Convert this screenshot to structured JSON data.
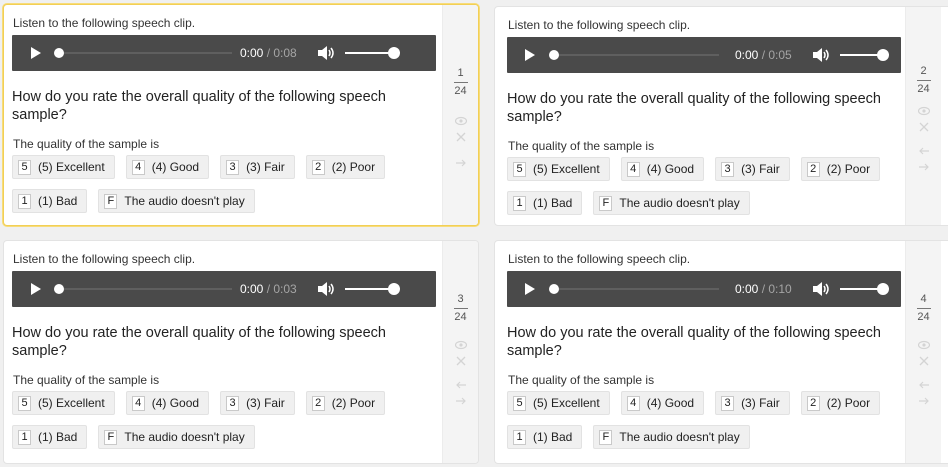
{
  "tasks": [
    {
      "instruction": "Listen to the following speech clip.",
      "time_current": "0:00",
      "time_sep": " / ",
      "time_duration": "0:08",
      "question": "How do you rate the overall quality of the following speech sample?",
      "quality_label": "The quality of the sample is",
      "options": [
        {
          "key": "5",
          "label": "(5) Excellent"
        },
        {
          "key": "4",
          "label": "(4) Good"
        },
        {
          "key": "3",
          "label": "(3) Fair"
        },
        {
          "key": "2",
          "label": "(2) Poor"
        },
        {
          "key": "1",
          "label": "(1) Bad"
        },
        {
          "key": "F",
          "label": "The audio doesn't play"
        }
      ],
      "index": "1",
      "total": "24"
    },
    {
      "instruction": "Listen to the following speech clip.",
      "time_current": "0:00",
      "time_sep": " / ",
      "time_duration": "0:05",
      "question": "How do you rate the overall quality of the following speech sample?",
      "quality_label": "The quality of the sample is",
      "options": [
        {
          "key": "5",
          "label": "(5) Excellent"
        },
        {
          "key": "4",
          "label": "(4) Good"
        },
        {
          "key": "3",
          "label": "(3) Fair"
        },
        {
          "key": "2",
          "label": "(2) Poor"
        },
        {
          "key": "1",
          "label": "(1) Bad"
        },
        {
          "key": "F",
          "label": "The audio doesn't play"
        }
      ],
      "index": "2",
      "total": "24"
    },
    {
      "instruction": "Listen to the following speech clip.",
      "time_current": "0:00",
      "time_sep": " / ",
      "time_duration": "0:03",
      "question": "How do you rate the overall quality of the following speech sample?",
      "quality_label": "The quality of the sample is",
      "options": [
        {
          "key": "5",
          "label": "(5) Excellent"
        },
        {
          "key": "4",
          "label": "(4) Good"
        },
        {
          "key": "3",
          "label": "(3) Fair"
        },
        {
          "key": "2",
          "label": "(2) Poor"
        },
        {
          "key": "1",
          "label": "(1) Bad"
        },
        {
          "key": "F",
          "label": "The audio doesn't play"
        }
      ],
      "index": "3",
      "total": "24"
    },
    {
      "instruction": "Listen to the following speech clip.",
      "time_current": "0:00",
      "time_sep": " / ",
      "time_duration": "0:10",
      "question": "How do you rate the overall quality of the following speech sample?",
      "quality_label": "The quality of the sample is",
      "options": [
        {
          "key": "5",
          "label": "(5) Excellent"
        },
        {
          "key": "4",
          "label": "(4) Good"
        },
        {
          "key": "3",
          "label": "(3) Fair"
        },
        {
          "key": "2",
          "label": "(2) Poor"
        },
        {
          "key": "1",
          "label": "(1) Bad"
        },
        {
          "key": "F",
          "label": "The audio doesn't play"
        }
      ],
      "index": "4",
      "total": "24"
    }
  ],
  "colors": {
    "active_border": "#f2cf55",
    "player_bg": "#4a4a4a",
    "option_bg": "#f0f0f0",
    "side_bg": "#f4f4f4"
  },
  "icons": [
    "play-icon",
    "volume-icon",
    "eye-icon",
    "close-icon",
    "arrow-left-icon",
    "arrow-right-icon"
  ]
}
